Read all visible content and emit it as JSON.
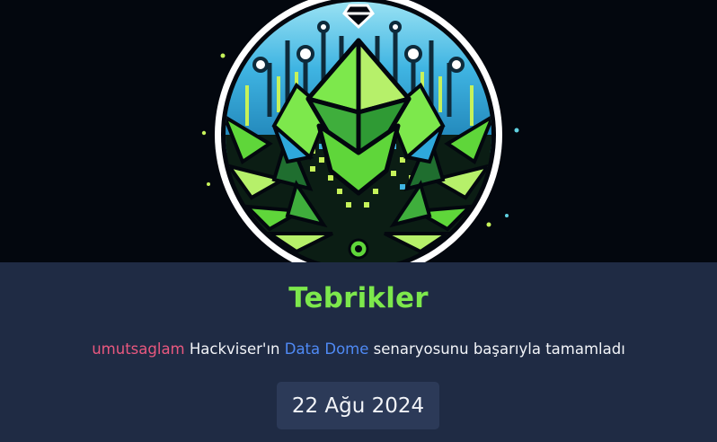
{
  "certificate": {
    "title": "Tebrikler",
    "message": {
      "username": "umutsaglam",
      "before_scenario": " Hackviser'ın ",
      "scenario": "Data Dome",
      "after_scenario": " senaryosunu başarıyla tamamladı"
    },
    "date": "22 Ağu 2024"
  },
  "badge": {
    "icon": "data-dome-badge-icon",
    "colors": {
      "background": "#03070e",
      "green": "#5fd63a",
      "light_green": "#b6f06a",
      "blue": "#2ea8dc",
      "dark_green": "#1f6e2f"
    }
  },
  "colors": {
    "panel": "#1f2b44",
    "title": "#7de84c",
    "username": "#e9587f",
    "scenario": "#4f8af5",
    "date_box": "#2c3a58",
    "text": "#f2f4f8"
  }
}
